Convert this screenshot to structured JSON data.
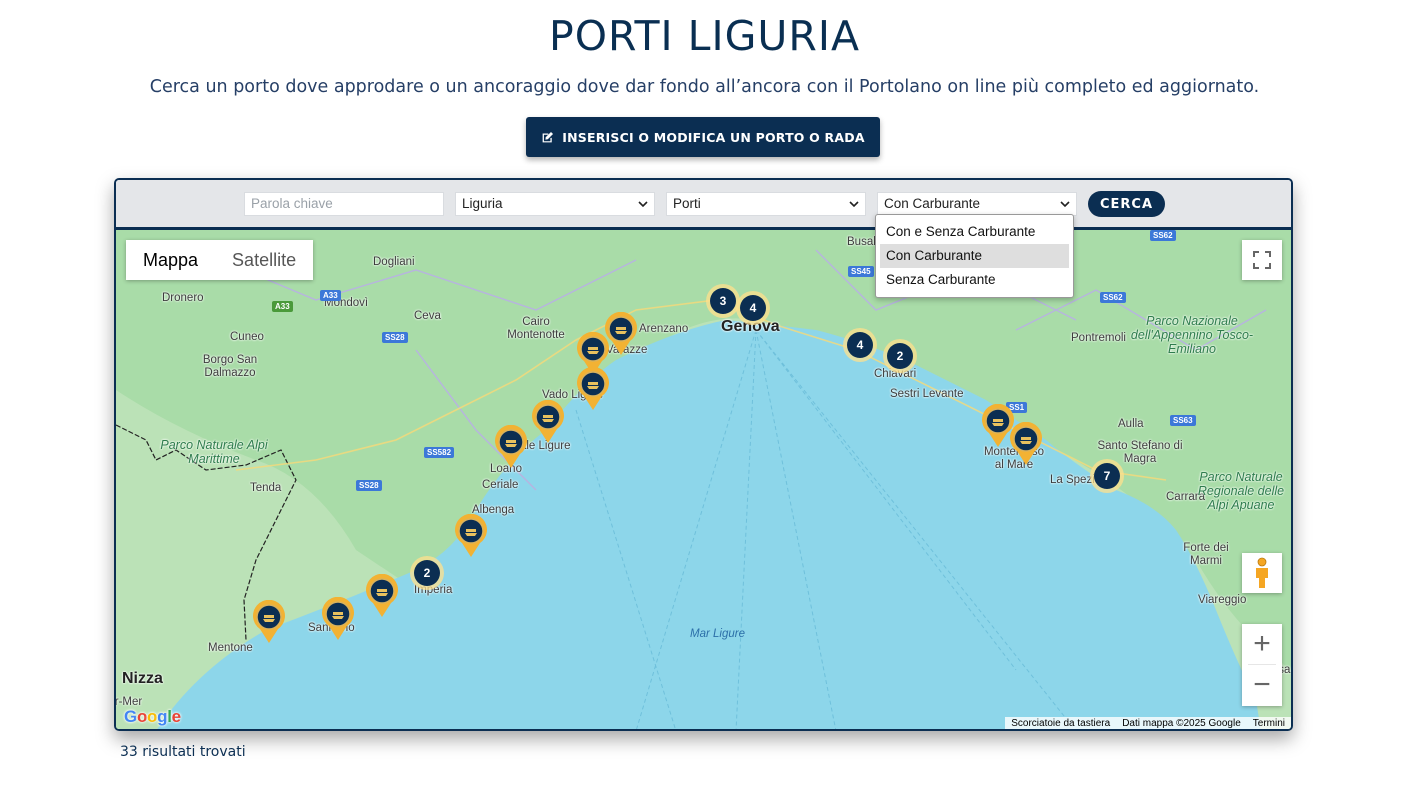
{
  "header": {
    "title": "PORTI LIGURIA",
    "subtitle": "Cerca un porto dove approdare o un ancoraggio dove dar fondo all’ancora con il Portolano on line più completo ed aggiornato.",
    "cta_label": "INSERISCI O MODIFICA UN PORTO O RADA",
    "cta_icon": "edit-icon"
  },
  "filters": {
    "keyword_placeholder": "Parola chiave",
    "region": "Liguria",
    "type": "Porti",
    "fuel": "Con Carburante",
    "fuel_options": [
      "Con e Senza Carburante",
      "Con Carburante",
      "Senza Carburante"
    ],
    "search_label": "CERCA"
  },
  "map": {
    "type_tabs": [
      "Mappa",
      "Satellite"
    ],
    "active_type": "Mappa",
    "fullscreen_icon": "fullscreen-icon",
    "pegman_icon": "pegman-icon",
    "zoom_in": "+",
    "zoom_out": "−",
    "cities": {
      "genova": "Genova",
      "nizza": "Nizza",
      "sanremo": "Sanremo",
      "mentone": "Mentone",
      "imperia": "Imperia",
      "albenga": "Albenga",
      "loano": "Loano",
      "ceriale": "Ceriale",
      "finale": "Finale Ligure",
      "vado": "Vado Ligure",
      "varazze": "Varazze",
      "arenzano": "Arenzano",
      "chiavari": "Chiavari",
      "sestri": "Sestri Levante",
      "monterosso": "Monterosso al Mare",
      "laspezia": "La Spezia",
      "santo_stefano": "Santo Stefano di Magra",
      "carrara": "Carrara",
      "forte": "Forte dei Marmi",
      "viareggio": "Viareggio",
      "aulla": "Aulla",
      "pontremoli": "Pontremoli",
      "busalla": "Busalla",
      "cairo": "Cairo Montenotte",
      "ceva": "Ceva",
      "mondovi": "Mondovì",
      "cuneo": "Cuneo",
      "dronero": "Dronero",
      "dogliani": "Dogliani",
      "borgo": "Borgo San Dalmazzo",
      "tenda": "Tenda",
      "pisa": "Pisa",
      "beaulieu": "Beaulieu-sur-Mer"
    },
    "parks": {
      "alpi_marittime": "Parco Naturale Alpi Marittime",
      "appennino": "Parco Nazionale dell'Appennino Tosco-Emiliano",
      "alpi_apuane": "Parco Naturale Regionale delle Alpi Apuane"
    },
    "sea_label": "Mar Ligure",
    "roads": [
      "A33",
      "SS28",
      "SS582",
      "SS28",
      "SS45",
      "SS62",
      "SS1",
      "SS63",
      "SS62"
    ],
    "clusters": [
      "3",
      "4",
      "4",
      "2",
      "2",
      "7"
    ],
    "attribution": [
      "Scorciatoie da tastiera",
      "Dati mappa ©2025 Google",
      "Termini"
    ],
    "google_logo": "Google",
    "colors": {
      "sea": "#8dd6ea",
      "land": "#a9dca8",
      "cluster": "#0b2e52",
      "marker": "#f2b233"
    }
  },
  "results": {
    "text": "33 risultati trovati"
  }
}
